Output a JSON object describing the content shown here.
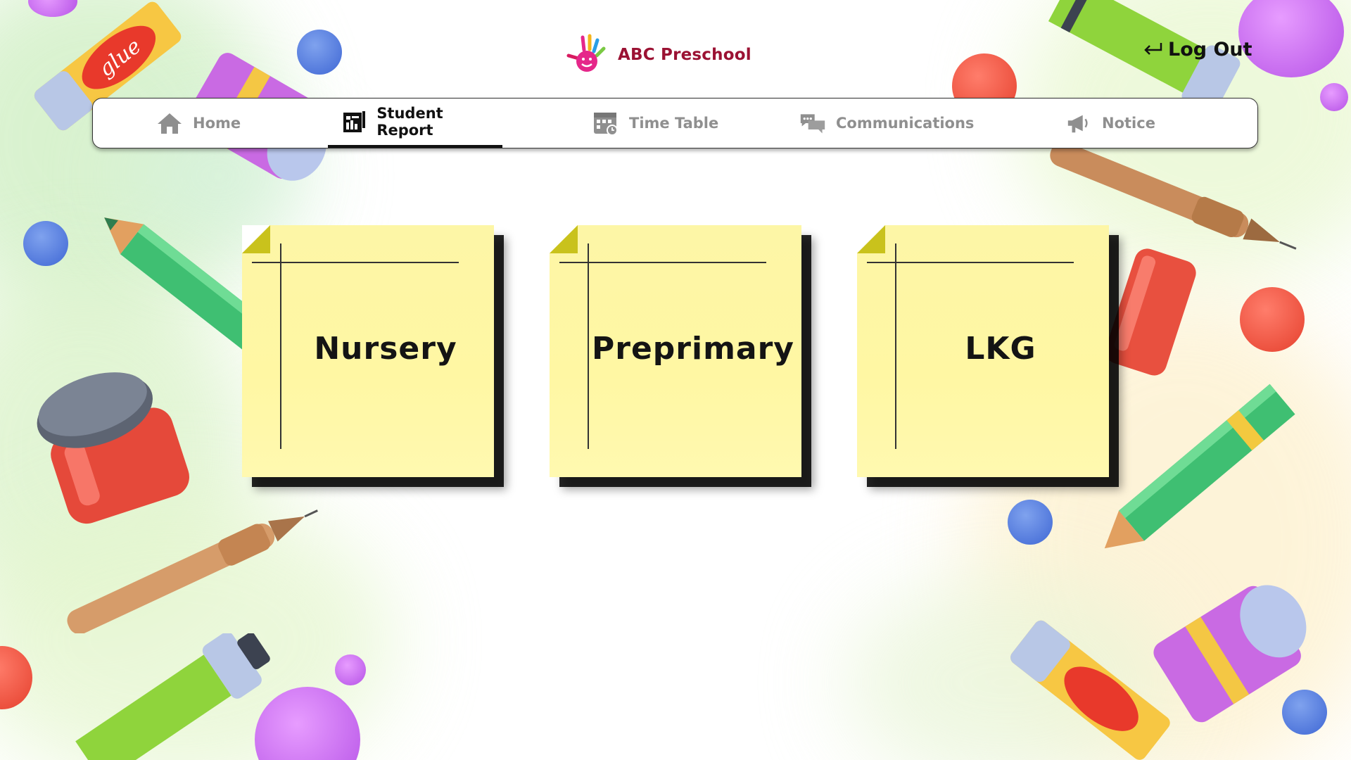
{
  "app": {
    "logo_text": "ABC Preschool",
    "logout_label": "Log Out"
  },
  "nav": {
    "items": [
      {
        "label": "Home",
        "icon": "home-icon",
        "active": false
      },
      {
        "label": "Student Report",
        "icon": "report-icon",
        "active": true
      },
      {
        "label": "Time Table",
        "icon": "calendar-icon",
        "active": false
      },
      {
        "label": "Communications",
        "icon": "chat-icon",
        "active": false
      },
      {
        "label": "Notice",
        "icon": "megaphone-icon",
        "active": false
      }
    ]
  },
  "classes": [
    {
      "label": "Nursery"
    },
    {
      "label": "Preprimary"
    },
    {
      "label": "LKG"
    }
  ],
  "decor": {
    "glue_label": "glue"
  },
  "colors": {
    "brand": "#9b1233",
    "note_yellow": "#fff7a3",
    "nav_inactive": "#8f8f8f"
  }
}
